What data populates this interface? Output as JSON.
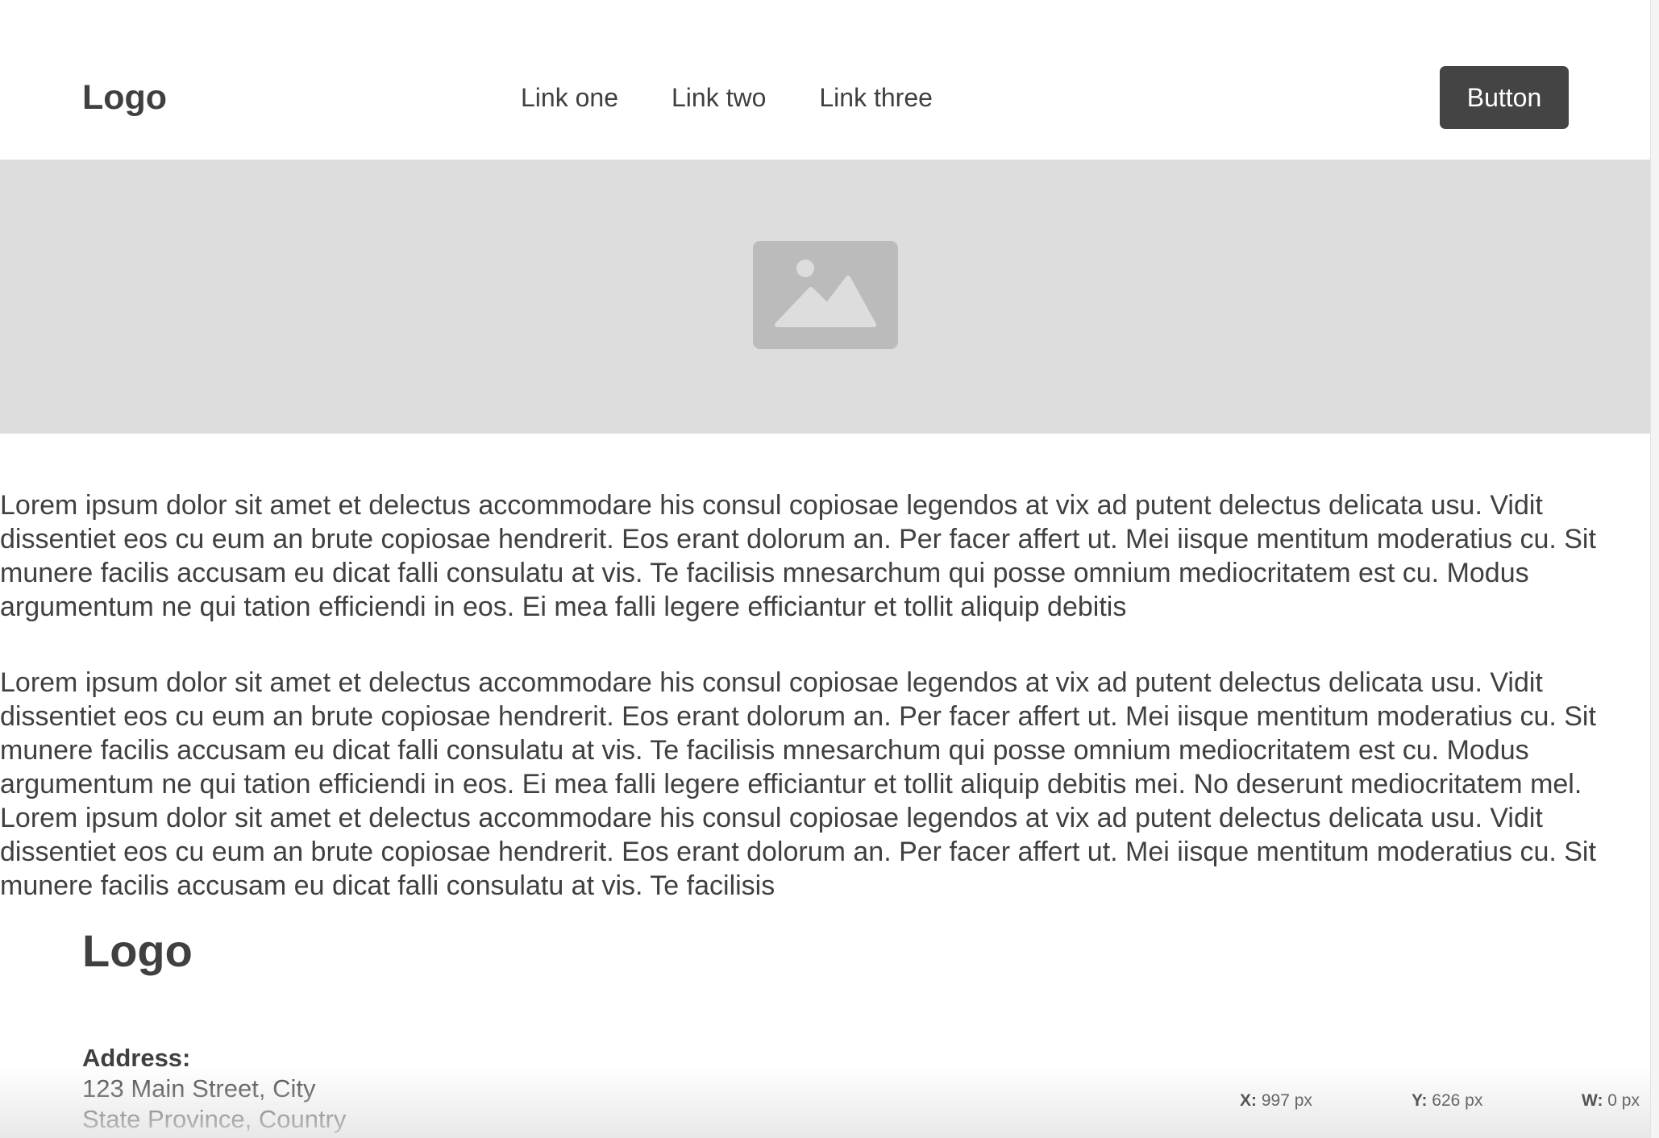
{
  "nav": {
    "logo": "Logo",
    "links": [
      "Link one",
      "Link two",
      "Link three"
    ],
    "button": "Button"
  },
  "hero": {
    "icon": "image-placeholder-icon",
    "background_color": "#dddddd"
  },
  "content": {
    "paragraphs": [
      "Lorem ipsum dolor sit amet et delectus accommodare his consul copiosae legendos at vix ad putent delectus delicata usu. Vidit dissentiet eos cu eum an brute copiosae hendrerit. Eos erant dolorum an. Per facer affert ut. Mei iisque mentitum moderatius cu. Sit munere facilis accusam eu dicat falli consulatu at vis. Te facilisis mnesarchum qui posse omnium mediocritatem est cu. Modus argumentum ne qui tation efficiendi in eos. Ei mea falli legere efficiantur et tollit aliquip debitis",
      "Lorem ipsum dolor sit amet et delectus accommodare his consul copiosae legendos at vix ad putent delectus delicata usu. Vidit dissentiet eos cu eum an brute copiosae hendrerit. Eos erant dolorum an. Per facer affert ut. Mei iisque mentitum moderatius cu. Sit munere facilis accusam eu dicat falli consulatu at vis. Te facilisis mnesarchum qui posse omnium mediocritatem est cu. Modus argumentum ne qui tation efficiendi in eos. Ei mea falli legere efficiantur et tollit aliquip debitis mei. No deserunt mediocritatem mel. Lorem ipsum dolor sit amet et delectus accommodare his consul copiosae legendos at vix ad putent delectus delicata usu. Vidit dissentiet eos cu eum an brute copiosae hendrerit. Eos erant dolorum an. Per facer affert ut. Mei iisque mentitum moderatius cu. Sit munere facilis accusam eu dicat falli consulatu at vis. Te facilisis"
    ]
  },
  "footer": {
    "logo": "Logo",
    "address_label": "Address:",
    "address_lines": [
      "123 Main Street, City",
      "State Province, Country"
    ]
  },
  "inspector": {
    "x_label": "X:",
    "x_value": "997 px",
    "y_label": "Y:",
    "y_value": "626 px",
    "w_label": "W:",
    "w_value": "0 px"
  },
  "colors": {
    "text": "#404040",
    "button_bg": "#444444",
    "button_text": "#ffffff",
    "placeholder_icon": "#bbbbbb"
  }
}
